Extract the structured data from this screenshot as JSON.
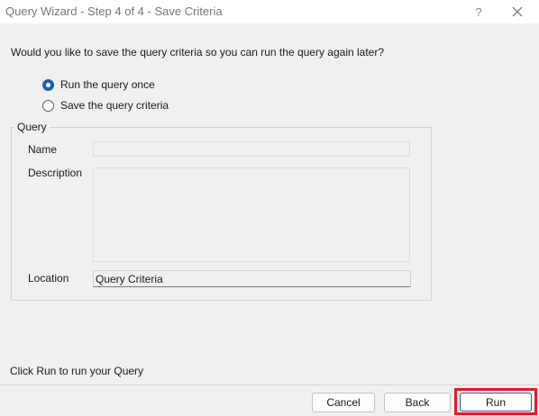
{
  "window": {
    "title": "Query Wizard - Step 4 of 4 - Save Criteria",
    "help_glyph": "?",
    "close_icon": "close-icon"
  },
  "question": "Would you like to save the query criteria so you can run the query again later?",
  "options": [
    {
      "label": "Run the query once",
      "selected": true
    },
    {
      "label": "Save the query criteria",
      "selected": false
    }
  ],
  "query_group": {
    "legend": "Query",
    "name_label": "Name",
    "name_value": "",
    "description_label": "Description",
    "description_value": "",
    "location_label": "Location",
    "location_value": "Query Criteria"
  },
  "footer": {
    "hint": "Click Run to run your Query",
    "cancel_label": "Cancel",
    "back_label": "Back",
    "run_label": "Run"
  },
  "colors": {
    "accent": "#1f5fa8",
    "highlight": "#e21b23"
  }
}
